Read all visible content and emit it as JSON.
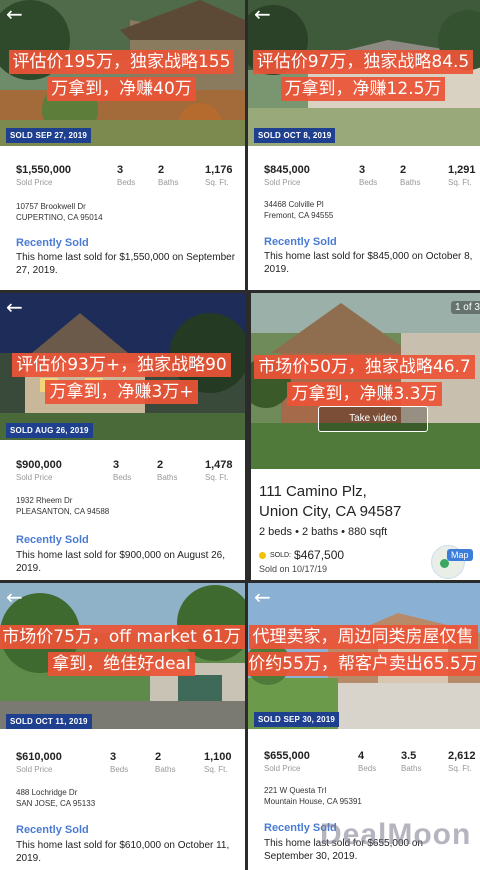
{
  "listings": [
    {
      "overlay": [
        "评估价195万，独家战略155",
        "万拿到，净赚40万"
      ],
      "badge": "SOLD SEP 27, 2019",
      "price": "$1,550,000",
      "price_label": "Sold Price",
      "beds": "3",
      "beds_label": "Beds",
      "baths": "2",
      "baths_label": "Baths",
      "sqft": "1,176",
      "sqft_label": "Sq. Ft.",
      "address1": "10757 Brookwell Dr",
      "address2": "CUPERTINO, CA 95014",
      "recently_sold": "Recently Sold",
      "desc": "This home last sold for $1,550,000 on September 27, 2019."
    },
    {
      "overlay": [
        "评估价97万，独家战略84.5",
        "万拿到，净赚12.5万"
      ],
      "badge": "SOLD OCT 8, 2019",
      "price": "$845,000",
      "price_label": "Sold Price",
      "beds": "3",
      "beds_label": "Beds",
      "baths": "2",
      "baths_label": "Baths",
      "sqft": "1,291",
      "sqft_label": "Sq. Ft.",
      "address1": "34468 Colville Pl",
      "address2": "Fremont, CA 94555",
      "recently_sold": "Recently Sold",
      "desc": "This home last sold for $845,000 on October 8, 2019."
    },
    {
      "overlay": [
        "评估价93万+，独家战略90",
        "万拿到，净赚3万+"
      ],
      "badge": "SOLD AUG 26, 2019",
      "price": "$900,000",
      "price_label": "Sold Price",
      "beds": "3",
      "beds_label": "Beds",
      "baths": "2",
      "baths_label": "Baths",
      "sqft": "1,478",
      "sqft_label": "Sq. Ft.",
      "address1": "1932 Rheem Dr",
      "address2": "PLEASANTON, CA 94588",
      "recently_sold": "Recently Sold",
      "desc": "This home last sold for $900,000 on August 26, 2019."
    },
    {
      "overlay": [
        "市场价50万，独家战略46.7",
        "万拿到，净赚3.3万"
      ],
      "photo_counter": "1 of 3",
      "take_video": "Take video",
      "street": "111 Camino Plz,",
      "city": "Union City, CA 94587",
      "facts": "2 beds • 2 baths • 880 sqft",
      "sold_label": "SOLD:",
      "sold_price": "$467,500",
      "sold_date": "Sold on 10/17/19",
      "map_label": "Map"
    },
    {
      "overlay": [
        "市场价75万，off market 61万",
        "拿到，绝佳好deal"
      ],
      "badge": "SOLD OCT 11, 2019",
      "price": "$610,000",
      "price_label": "Sold Price",
      "beds": "3",
      "beds_label": "Beds",
      "baths": "2",
      "baths_label": "Baths",
      "sqft": "1,100",
      "sqft_label": "Sq. Ft.",
      "address1": "488 Lochridge Dr",
      "address2": "SAN JOSE, CA 95133",
      "recently_sold": "Recently Sold",
      "desc": "This home last sold for $610,000 on October 11, 2019."
    },
    {
      "overlay": [
        "代理卖家，周边同类房屋仅售",
        "价约55万，帮客户卖出65.5万"
      ],
      "badge": "SOLD SEP 30, 2019",
      "price": "$655,000",
      "price_label": "Sold Price",
      "beds": "4",
      "beds_label": "Beds",
      "baths": "3.5",
      "baths_label": "Baths",
      "sqft": "2,612",
      "sqft_label": "Sq. Ft.",
      "address1": "221 W Questa Trl",
      "address2": "Mountain House, CA 95391",
      "recently_sold": "Recently Sold",
      "desc": "This home last sold for $655,000 on September 30, 2019."
    }
  ],
  "back_icon": "←",
  "watermark": "DealMoon",
  "colors": {
    "overlay": "#EC5437",
    "badge": "#1F3F8F",
    "link": "#4A7BD4",
    "sold_dot": "#F2C200"
  }
}
